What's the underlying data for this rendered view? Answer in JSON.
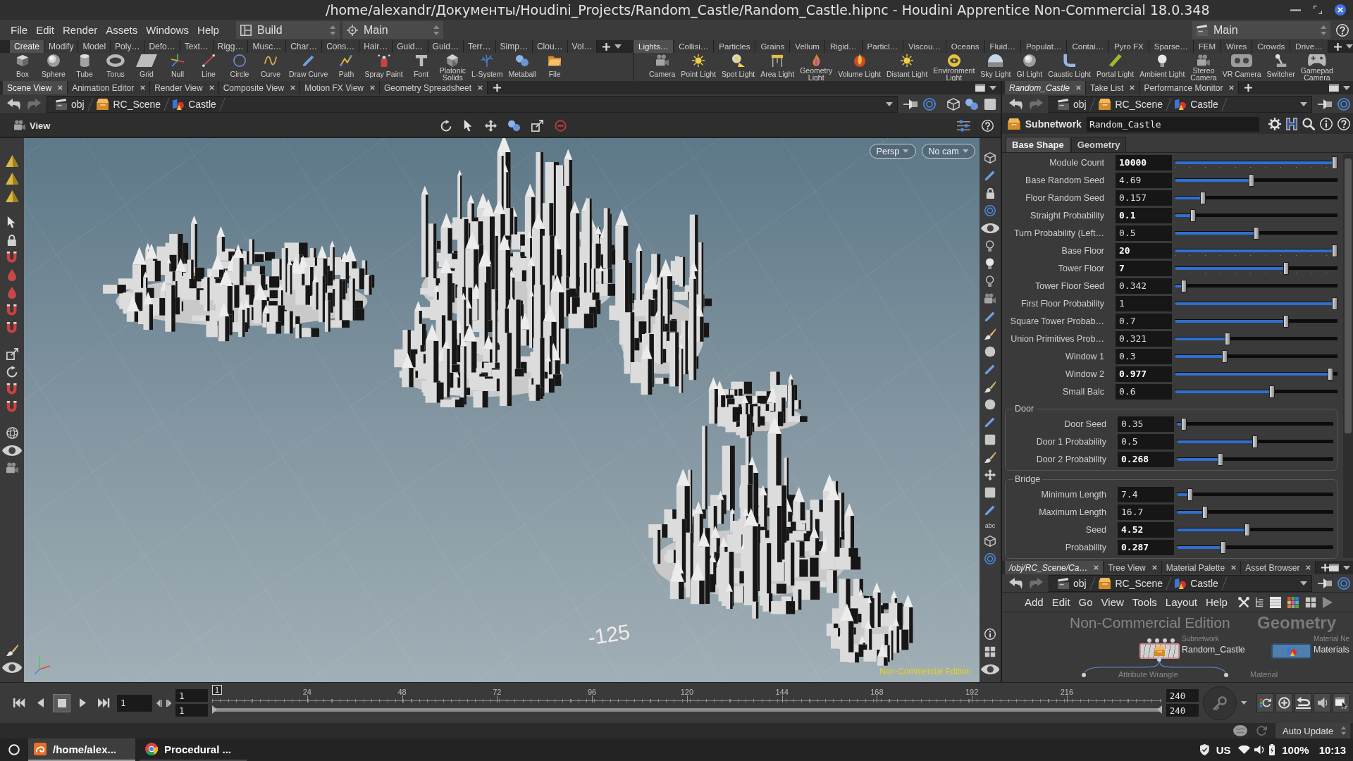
{
  "window": {
    "title": "/home/alexandr/Документы/Houdini_Projects/Random_Castle/Random_Castle.hipnc - Houdini Apprentice Non-Commercial 18.0.348"
  },
  "menu_bar": {
    "items": [
      "File",
      "Edit",
      "Render",
      "Assets",
      "Windows",
      "Help"
    ],
    "desktop": "Build",
    "context": "Main",
    "right_desktop": "Main"
  },
  "shelves": [
    {
      "tabs": [
        {
          "label": "Create",
          "selected": true
        },
        {
          "label": "Modify",
          "selected": false
        },
        {
          "label": "Model",
          "selected": false
        },
        {
          "label": "Poly…",
          "selected": false
        },
        {
          "label": "Defo…",
          "selected": false
        },
        {
          "label": "Text…",
          "selected": false
        },
        {
          "label": "Rigg…",
          "selected": false
        },
        {
          "label": "Musc…",
          "selected": false
        },
        {
          "label": "Char…",
          "selected": false
        },
        {
          "label": "Cons…",
          "selected": false
        },
        {
          "label": "Hair…",
          "selected": false
        },
        {
          "label": "Guid…",
          "selected": false
        },
        {
          "label": "Guid…",
          "selected": false
        },
        {
          "label": "Terr…",
          "selected": false
        },
        {
          "label": "Simp…",
          "selected": false
        },
        {
          "label": "Clou…",
          "selected": false
        },
        {
          "label": "Vol…",
          "selected": false
        }
      ],
      "tools": [
        "Box",
        "Sphere",
        "Tube",
        "Torus",
        "Grid",
        "Null",
        "Line",
        "Circle",
        "Curve",
        "Draw Curve",
        "Path",
        "Spray Paint",
        "Font",
        "Platonic\nSolids",
        "L-System",
        "Metaball",
        "File"
      ]
    },
    {
      "tabs": [
        {
          "label": "Lights…",
          "selected": true
        },
        {
          "label": "Collisi…",
          "selected": false
        },
        {
          "label": "Particles",
          "selected": false
        },
        {
          "label": "Grains",
          "selected": false
        },
        {
          "label": "Vellum",
          "selected": false
        },
        {
          "label": "Rigid…",
          "selected": false
        },
        {
          "label": "Particl…",
          "selected": false
        },
        {
          "label": "Viscou…",
          "selected": false
        },
        {
          "label": "Oceans",
          "selected": false
        },
        {
          "label": "Fluid…",
          "selected": false
        },
        {
          "label": "Populat…",
          "selected": false
        },
        {
          "label": "Contai…",
          "selected": false
        },
        {
          "label": "Pyro FX",
          "selected": false
        },
        {
          "label": "Sparse…",
          "selected": false
        },
        {
          "label": "FEM",
          "selected": false
        },
        {
          "label": "Wires",
          "selected": false
        },
        {
          "label": "Crowds",
          "selected": false
        },
        {
          "label": "Drive…",
          "selected": false
        }
      ],
      "tools": [
        "Camera",
        "Point Light",
        "Spot Light",
        "Area Light",
        "Geometry\nLight",
        "Volume Light",
        "Distant Light",
        "Environment\nLight",
        "Sky Light",
        "GI Light",
        "Caustic Light",
        "Portal Light",
        "Ambient Light",
        "Stereo\nCamera",
        "VR Camera",
        "Switcher",
        "Gamepad\nCamera"
      ]
    }
  ],
  "scene_pane": {
    "tabs": [
      {
        "label": "Scene View",
        "selected": true,
        "italic": false
      },
      {
        "label": "Animation Editor",
        "selected": false,
        "italic": false
      },
      {
        "label": "Render View",
        "selected": false,
        "italic": false
      },
      {
        "label": "Composite View",
        "selected": false,
        "italic": false
      },
      {
        "label": "Motion FX View",
        "selected": false,
        "italic": false
      },
      {
        "label": "Geometry Spreadsheet",
        "selected": false,
        "italic": false
      }
    ],
    "path": [
      "obj",
      "RC_Scene",
      "Castle"
    ],
    "viewer": {
      "title": "View",
      "view_menu": "Persp",
      "camera_menu": "No cam",
      "grid_label": "-125",
      "watermark": "Non-Commercial Edition",
      "toolbar_text": "abc"
    }
  },
  "parameter_pane": {
    "tabs": [
      {
        "label": "Random_Castle",
        "selected": true,
        "italic": true
      },
      {
        "label": "Take List",
        "selected": false,
        "italic": false
      },
      {
        "label": "Performance Monitor",
        "selected": false,
        "italic": false
      }
    ],
    "path": [
      "obj",
      "RC_Scene",
      "Castle"
    ],
    "node_type": "Subnetwork",
    "node_name": "Random_Castle",
    "folders": [
      {
        "label": "Base Shape",
        "selected": true
      },
      {
        "label": "Geometry",
        "selected": false
      }
    ],
    "parameters": [
      {
        "label": "Module Count",
        "value": "10000",
        "changed": true,
        "kind": "int",
        "level": 1
      },
      {
        "label": "Base Random Seed",
        "value": "4.69",
        "changed": false,
        "kind": "float",
        "level": 0.47
      },
      {
        "label": "Floor Random Seed",
        "value": "0.157",
        "changed": false,
        "kind": "float",
        "level": 0.16
      },
      {
        "label": "Straight Probability",
        "value": "0.1",
        "changed": true,
        "kind": "float",
        "level": 0.1
      },
      {
        "label": "Turn Probability (Left…",
        "value": "0.5",
        "changed": false,
        "kind": "float",
        "level": 0.5
      },
      {
        "label": "Base Floor",
        "value": "20",
        "changed": true,
        "kind": "int",
        "level": 1
      },
      {
        "label": "Tower Floor",
        "value": "7",
        "changed": true,
        "kind": "int",
        "level": 0.69
      },
      {
        "label": "Tower Floor Seed",
        "value": "0.342",
        "changed": false,
        "kind": "float",
        "level": 0.04
      },
      {
        "label": "First Floor Probability",
        "value": "1",
        "changed": false,
        "kind": "float",
        "level": 1
      },
      {
        "label": "Square Tower Probab…",
        "value": "0.7",
        "changed": false,
        "kind": "float",
        "level": 0.69
      },
      {
        "label": "Union Primitives Prob…",
        "value": "0.321",
        "changed": false,
        "kind": "float",
        "level": 0.32
      },
      {
        "label": "Window 1",
        "value": "0.3",
        "changed": false,
        "kind": "float",
        "level": 0.3
      },
      {
        "label": "Window 2",
        "value": "0.977",
        "changed": true,
        "kind": "float",
        "level": 0.97
      },
      {
        "label": "Small Balc",
        "value": "0.6",
        "changed": false,
        "kind": "float",
        "level": 0.6
      }
    ],
    "groups": [
      {
        "title": "Door",
        "parameters": [
          {
            "label": "Door Seed",
            "value": "0.35",
            "changed": false,
            "kind": "float",
            "level": 0.03
          },
          {
            "label": "Door 1 Probability",
            "value": "0.5",
            "changed": false,
            "kind": "float",
            "level": 0.5
          },
          {
            "label": "Door 2 Probability",
            "value": "0.268",
            "changed": true,
            "kind": "float",
            "level": 0.27
          }
        ]
      },
      {
        "title": "Bridge",
        "parameters": [
          {
            "label": "Minimum Length",
            "value": "7.4",
            "changed": false,
            "kind": "float",
            "level": 0.07
          },
          {
            "label": "Maximum Length",
            "value": "16.7",
            "changed": false,
            "kind": "float",
            "level": 0.17
          },
          {
            "label": "Seed",
            "value": "4.52",
            "changed": true,
            "kind": "float",
            "level": 0.45
          },
          {
            "label": "Probability",
            "value": "0.287",
            "changed": true,
            "kind": "float",
            "level": 0.29
          }
        ]
      }
    ]
  },
  "network_pane": {
    "tabs": [
      {
        "label": "/obj/RC_Scene/Ca…",
        "selected": true,
        "italic": true
      },
      {
        "label": "Tree View",
        "selected": false,
        "italic": false
      },
      {
        "label": "Material Palette",
        "selected": false,
        "italic": false
      },
      {
        "label": "Asset Browser",
        "selected": false,
        "italic": false
      }
    ],
    "path": [
      "obj",
      "RC_Scene",
      "Castle"
    ],
    "menu": [
      "Add",
      "Edit",
      "Go",
      "View",
      "Tools",
      "Layout",
      "Help"
    ],
    "watermark": "Non-Commercial Edition",
    "context": "Geometry",
    "nodes": [
      {
        "kind": "subnet",
        "type": "Subnetwork",
        "name": "Random_Castle",
        "selected": true
      },
      {
        "kind": "matnet",
        "type": "Material Ne",
        "name": "Materials",
        "selected": false
      }
    ],
    "partial_nodes": [
      "Attribute Wrangle",
      "Material"
    ]
  },
  "timeline": {
    "frame": "1",
    "marker": "1",
    "start": "1",
    "playback_start": "1",
    "playback_end": "240",
    "end": "240",
    "ticks": [
      "24",
      "48",
      "72",
      "96",
      "120",
      "144",
      "168",
      "192",
      "216"
    ],
    "range": {
      "level": 1
    },
    "playing": false
  },
  "status_bar": {
    "update_mode": "Auto Update"
  },
  "taskbar": {
    "tasks": [
      {
        "label": "/home/alex...",
        "selected": true
      },
      {
        "label": "Procedural ...",
        "selected": false
      }
    ],
    "keyboard": "US",
    "battery": "100%",
    "clock": "10:13"
  }
}
